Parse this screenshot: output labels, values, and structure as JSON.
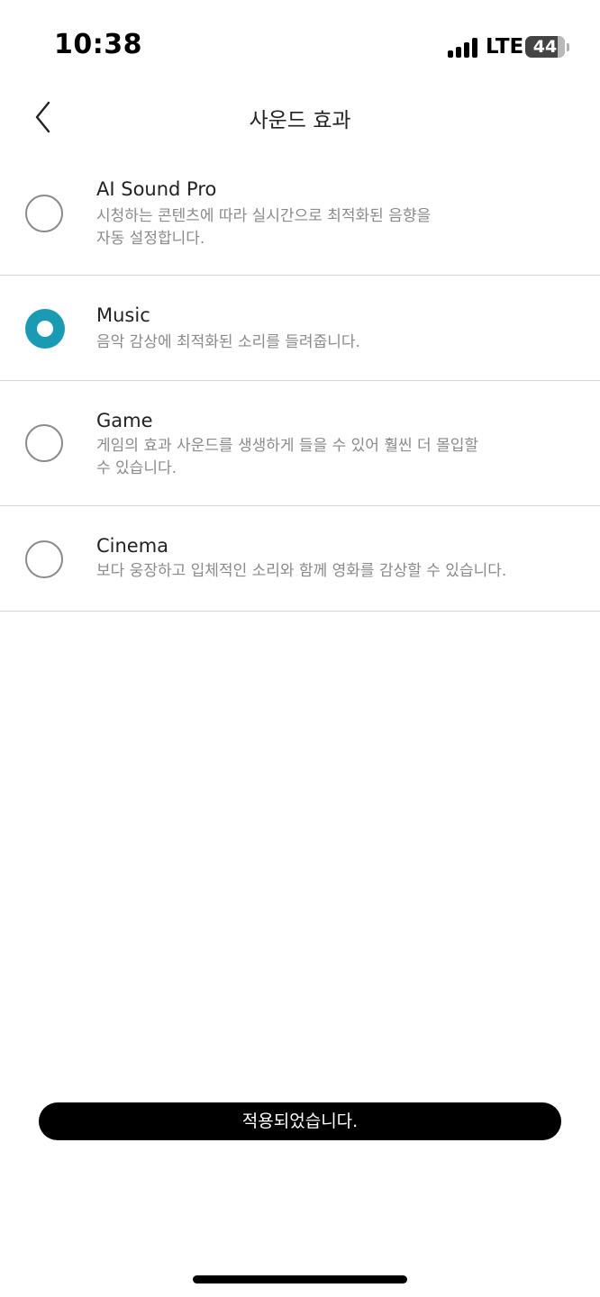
{
  "status_bar": {
    "time": "10:38",
    "network": "LTE",
    "battery": "44",
    "battery_level": 0.44
  },
  "header": {
    "title": "사운드 효과",
    "back_icon": "chevron-left-icon"
  },
  "options": [
    {
      "title": "AI Sound Pro",
      "desc_lines": [
        "시청하는 콘텐츠에 따라 실시간으로 최적화된 음향을",
        "자동 설정합니다."
      ],
      "selected": false
    },
    {
      "title": "Music",
      "desc_lines": [
        "음악 감상에 최적화된 소리를 들려줍니다."
      ],
      "selected": true
    },
    {
      "title": "Game",
      "desc_lines": [
        "게임의 효과 사운드를 생생하게 들을 수 있어 훨씬 더 몰입할",
        "수 있습니다."
      ],
      "selected": false
    },
    {
      "title": "Cinema",
      "desc_lines": [
        "보다 웅장하고 입체적인 소리와 함께 영화를 감상할 수 있습니다."
      ],
      "selected": false
    }
  ],
  "toast": {
    "message": "적용되었습니다."
  },
  "colors": {
    "accent": "#1a9bb3",
    "divider": "#d6d6d6",
    "secondary_text": "#8a8a8a"
  }
}
